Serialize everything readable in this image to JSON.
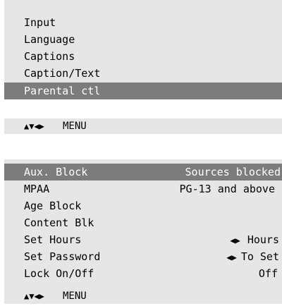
{
  "top_menu": {
    "items": [
      {
        "label": "Input"
      },
      {
        "label": "Language"
      },
      {
        "label": "Captions"
      },
      {
        "label": "Caption/Text"
      },
      {
        "label": "Parental ctl",
        "selected": true
      }
    ],
    "nav": {
      "arrows": "▲▼◀▶",
      "menu_label": "MENU"
    }
  },
  "parental_menu": {
    "rows": [
      {
        "label": "Aux. Block",
        "value": "Sources blocked",
        "selected": true
      },
      {
        "label": "MPAA",
        "value": "PG-13 and above"
      },
      {
        "label": "Age Block",
        "value": ""
      },
      {
        "label": "Content Blk",
        "value": ""
      },
      {
        "label": "Set Hours",
        "arrows": "◀▶",
        "value": "Hours"
      },
      {
        "label": "Set Password",
        "arrows": "◀▶",
        "value": "To Set"
      },
      {
        "label": "Lock On/Off",
        "value": "Off"
      }
    ],
    "nav": {
      "arrows": "▲▼◀▶",
      "menu_label": "MENU"
    }
  },
  "colors": {
    "panel_bg": "#e6e6e6",
    "selected_bg": "#7c7c7c",
    "selected_text": "#ffffff"
  }
}
